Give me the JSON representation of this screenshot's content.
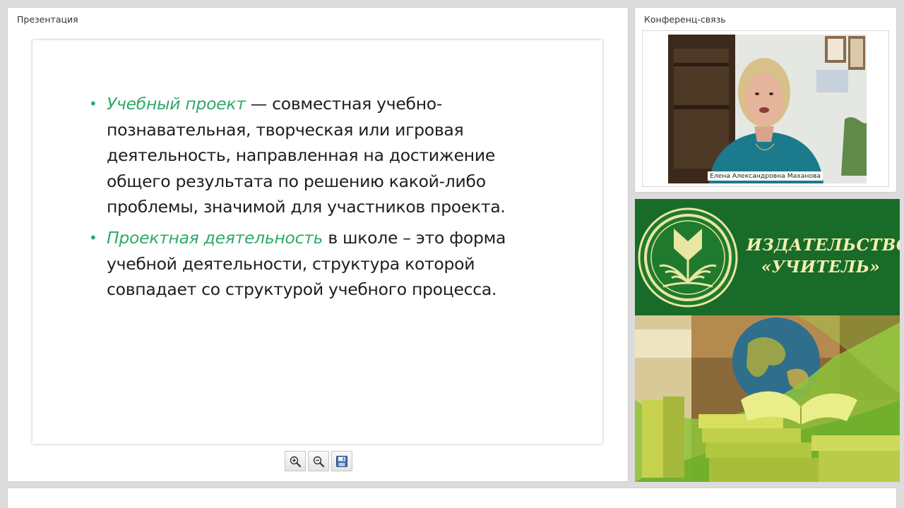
{
  "presentation": {
    "title": "Презентация",
    "slide": {
      "bullets": [
        {
          "term": "Учебный проект",
          "text": " — совместная учебно-познавательная, творческая или игровая деятельность, направленная на достижение общего результата по решению какой-либо проблемы, значимой для участников проекта."
        },
        {
          "term": "Проектная деятельность",
          "text": " в школе – это форма учебной деятельности, структура которой совпадает со структурой учебного процесса."
        }
      ]
    },
    "toolbar": {
      "zoom_in_icon": "zoom-in-icon",
      "zoom_out_icon": "zoom-out-icon",
      "save_icon": "floppy-disk-icon"
    }
  },
  "conference": {
    "title": "Конференц-связь",
    "speaker_name": "Елена Александровна Маханова"
  },
  "publisher": {
    "name_line1": "ИЗДАТЕЛЬСТВО",
    "name_line2": "«УЧИТЕЛЬ»"
  },
  "colors": {
    "accent_green": "#2eaa6a",
    "publisher_green": "#186b28",
    "publisher_text": "#f4efb0",
    "page_background": "#dcdcdc"
  }
}
